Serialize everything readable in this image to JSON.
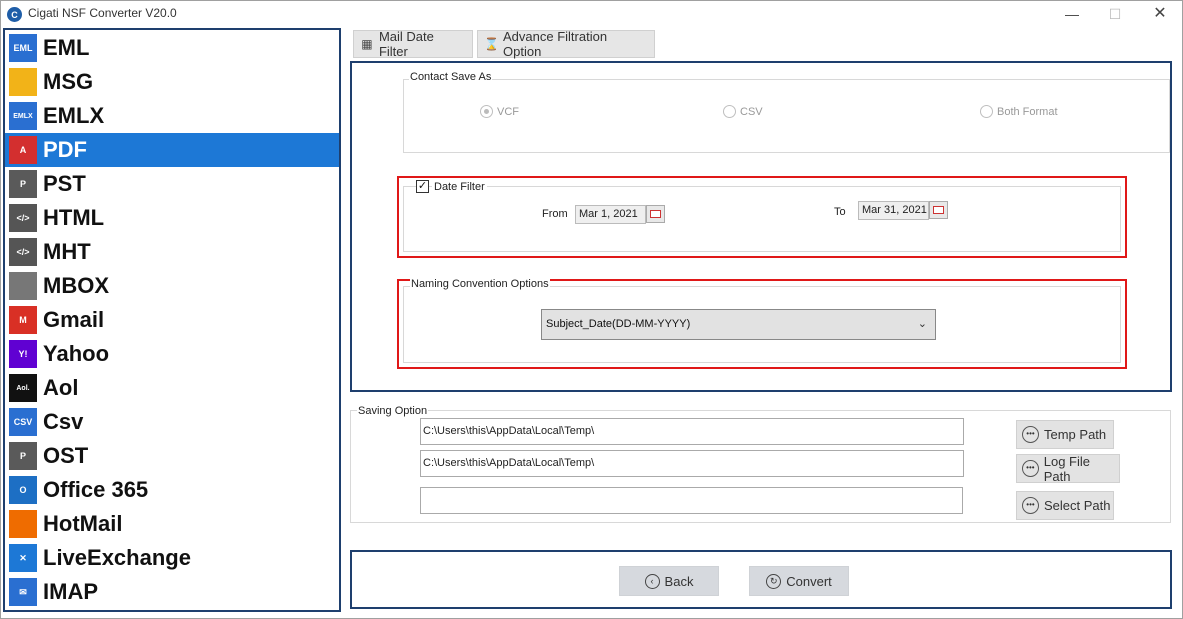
{
  "window": {
    "title": "Cigati NSF Converter V20.0",
    "app_icon": "C",
    "min_glyph": "—",
    "max_glyph": "☐",
    "close_glyph": "✕"
  },
  "sidebar": {
    "items": [
      {
        "label": "EML",
        "icon": "eml-icon",
        "badge": "EML",
        "color": "#2a6fd1"
      },
      {
        "label": "MSG",
        "icon": "envelope-icon",
        "badge": "",
        "color": "#f2b318"
      },
      {
        "label": "EMLX",
        "icon": "emlx-icon",
        "badge": "EMLX",
        "color": "#2a6fd1"
      },
      {
        "label": "PDF",
        "icon": "pdf-icon",
        "badge": "A",
        "color": "#d32f2f"
      },
      {
        "label": "PST",
        "icon": "pst-icon",
        "badge": "P",
        "color": "#5a5a5a"
      },
      {
        "label": "HTML",
        "icon": "html-icon",
        "badge": "</>",
        "color": "#555555"
      },
      {
        "label": "MHT",
        "icon": "mht-icon",
        "badge": "</>",
        "color": "#555555"
      },
      {
        "label": "MBOX",
        "icon": "mbox-icon",
        "badge": "",
        "color": "#777777"
      },
      {
        "label": "Gmail",
        "icon": "gmail-icon",
        "badge": "M",
        "color": "#d93025"
      },
      {
        "label": "Yahoo",
        "icon": "yahoo-icon",
        "badge": "Y!",
        "color": "#6001d2"
      },
      {
        "label": "Aol",
        "icon": "aol-icon",
        "badge": "Aol.",
        "color": "#111111"
      },
      {
        "label": "Csv",
        "icon": "csv-icon",
        "badge": "CSV",
        "color": "#2a6fd1"
      },
      {
        "label": "OST",
        "icon": "ost-icon",
        "badge": "P",
        "color": "#5a5a5a"
      },
      {
        "label": "Office 365",
        "icon": "office365-icon",
        "badge": "O",
        "color": "#1d6fc4"
      },
      {
        "label": "HotMail",
        "icon": "hotmail-icon",
        "badge": "",
        "color": "#ef6c00"
      },
      {
        "label": "LiveExchange",
        "icon": "liveexchange-icon",
        "badge": "✕",
        "color": "#1d78d6"
      },
      {
        "label": "IMAP",
        "icon": "imap-icon",
        "badge": "✉",
        "color": "#2a6fd1"
      }
    ],
    "active_index": 3
  },
  "tabs": [
    {
      "label": "Mail Date Filter",
      "icon": "calendar-icon",
      "glyph": "▦"
    },
    {
      "label": "Advance Filtration Option",
      "icon": "hourglass-icon",
      "glyph": "⌛"
    }
  ],
  "contact": {
    "group_label": "Contact Save As",
    "options": [
      "VCF",
      "CSV",
      "Both Format"
    ],
    "selected": 0
  },
  "date_filter": {
    "label": "Date Filter",
    "checked": true,
    "check_glyph": "✓",
    "from_label": "From",
    "from_value": "Mar 1, 2021",
    "to_label": "To",
    "to_value": "Mar 31, 2021"
  },
  "naming": {
    "group_label": "Naming Convention Options",
    "selected": "Subject_Date(DD-MM-YYYY)",
    "chev": "⌄"
  },
  "saving": {
    "group_label": "Saving Option",
    "temp_path_value": "C:\\Users\\this\\AppData\\Local\\Temp\\",
    "log_path_value": "C:\\Users\\this\\AppData\\Local\\Temp\\",
    "select_path_value": "",
    "temp_btn": "Temp Path",
    "log_btn": "Log File Path",
    "select_btn": "Select Path",
    "btn_glyph": "•••"
  },
  "actions": {
    "back": "Back",
    "back_glyph": "‹",
    "convert": "Convert",
    "convert_glyph": "↻"
  }
}
